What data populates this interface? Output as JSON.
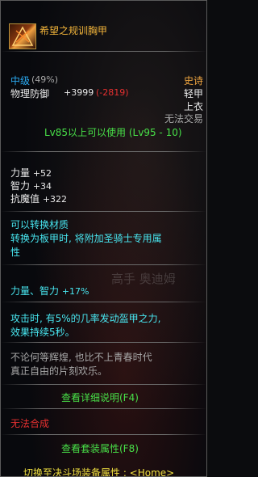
{
  "item": {
    "name": "希望之规训胸甲",
    "grade_label": "中级",
    "grade_percent": "(49%)",
    "rarity": "史诗",
    "armor_type": "轻甲",
    "slot": "上衣",
    "trade": "无法交易",
    "defense_label": "物理防御",
    "defense_value": "+3999",
    "defense_diff": "(-2819)",
    "level_req": "Lv85以上可以使用 (Lv95 - 10)"
  },
  "stats": [
    {
      "label": "力量",
      "value": "+52"
    },
    {
      "label": "智力",
      "value": "+34"
    },
    {
      "label": "抗魔值",
      "value": "+322"
    }
  ],
  "conversion": {
    "line1": "可以转换材质",
    "line2": "转换为板甲时, 将附加圣骑士专用属",
    "line3": "性"
  },
  "bonus": {
    "label": "力量、智力",
    "value": "+17%"
  },
  "effect": {
    "line1": "攻击时, 有5%的几率发动盔甲之力,",
    "line2": "效果持续5秒。"
  },
  "flavor": {
    "line1": "不论何等辉煌, 也比不上青春时代",
    "line2": "真正自由的片刻欢乐。"
  },
  "buttons": {
    "details": "查看详细说明(F4)",
    "set_attr": "查看套装属性(F8)",
    "switch": "切换至决斗场装备属性 : <Home>"
  },
  "no_synthesis": "无法合成",
  "watermark": "高手 奥迪姆",
  "colors": {
    "name": "#f2b43a",
    "blue": "#2aa9f0",
    "rarity": "#f0a640",
    "red": "#e63030",
    "cyan": "#48e6f0",
    "green": "#48e048"
  }
}
